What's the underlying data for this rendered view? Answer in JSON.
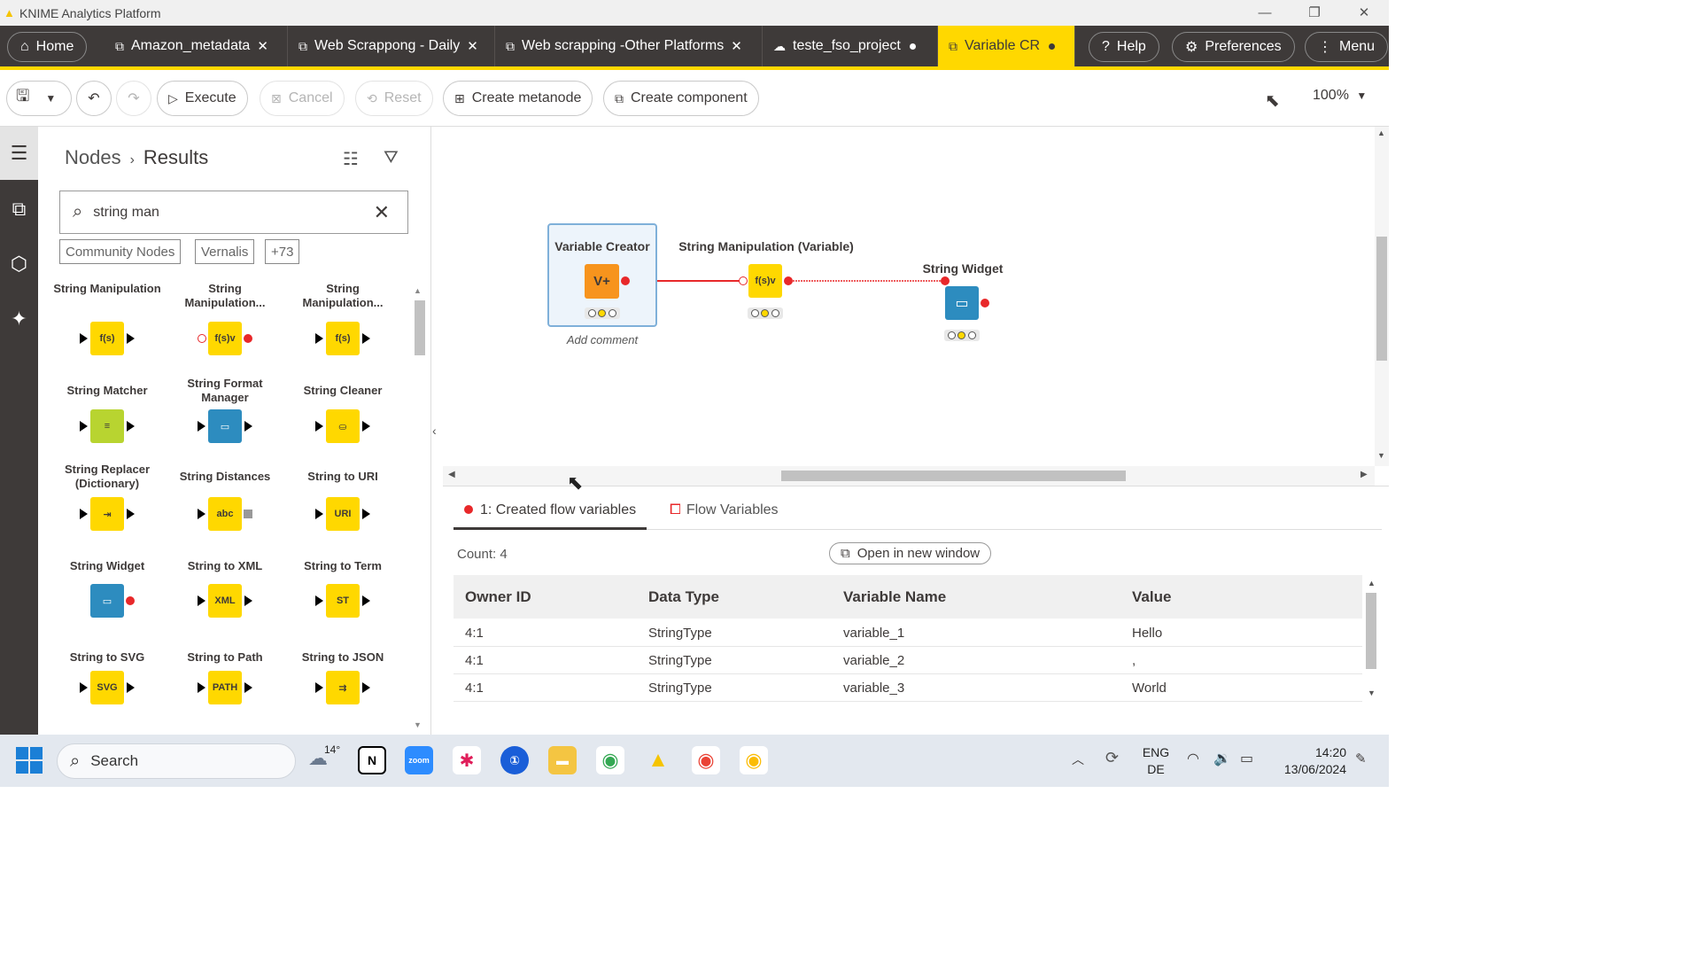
{
  "window": {
    "title": "KNIME Analytics Platform"
  },
  "tabs": [
    {
      "label": "Home"
    },
    {
      "label": "Amazon_metadata"
    },
    {
      "label": "Web Scrappong - Daily"
    },
    {
      "label": "Web scrapping -Other Platforms"
    },
    {
      "label": "teste_fso_project"
    },
    {
      "label": "Variable CR"
    }
  ],
  "top_right": {
    "help": "Help",
    "preferences": "Preferences",
    "menu": "Menu"
  },
  "toolbar": {
    "execute": "Execute",
    "cancel": "Cancel",
    "reset": "Reset",
    "create_metanode": "Create metanode",
    "create_component": "Create component",
    "zoom": "100%"
  },
  "side_panel": {
    "breadcrumb_root": "Nodes",
    "breadcrumb_current": "Results",
    "search_value": "string man",
    "tags": [
      "Community Nodes",
      "Vernalis",
      "+73"
    ],
    "nodes": [
      {
        "label": "String Manipulation",
        "color": "#ffd800",
        "glyph": "f(s)"
      },
      {
        "label": "String Manipulation...",
        "color": "#ffd800",
        "glyph": "f(s)v"
      },
      {
        "label": "String Manipulation...",
        "color": "#ffd800",
        "glyph": "f(s)"
      },
      {
        "label": "String Matcher",
        "color": "#b8d430",
        "glyph": "≡"
      },
      {
        "label": "String Format Manager",
        "color": "#2d8cbf",
        "glyph": "▭"
      },
      {
        "label": "String Cleaner",
        "color": "#ffd800",
        "glyph": "⛀"
      },
      {
        "label": "String Replacer (Dictionary)",
        "color": "#ffd800",
        "glyph": "⇥"
      },
      {
        "label": "String Distances",
        "color": "#ffd800",
        "glyph": "abc"
      },
      {
        "label": "String to URI",
        "color": "#ffd800",
        "glyph": "URI"
      },
      {
        "label": "String Widget",
        "color": "#2d8cbf",
        "glyph": "▭"
      },
      {
        "label": "String to XML",
        "color": "#ffd800",
        "glyph": "XML"
      },
      {
        "label": "String to Term",
        "color": "#ffd800",
        "glyph": "ST"
      },
      {
        "label": "String to SVG",
        "color": "#ffd800",
        "glyph": "SVG"
      },
      {
        "label": "String to Path",
        "color": "#ffd800",
        "glyph": "PATH"
      },
      {
        "label": "String to JSON",
        "color": "#ffd800",
        "glyph": "⇉"
      }
    ]
  },
  "canvas": {
    "nodes": [
      {
        "title": "Variable Creator",
        "glyph": "V+",
        "color": "#f7941d",
        "comment": "Add comment"
      },
      {
        "title": "String Manipulation (Variable)",
        "glyph": "f(s)v",
        "color": "#ffd800"
      },
      {
        "title": "String Widget",
        "glyph": "▭",
        "color": "#2d8cbf"
      }
    ]
  },
  "bottom_panel": {
    "tab_active": "1: Created flow variables",
    "tab_other": "Flow Variables",
    "count": "Count: 4",
    "open_new_window": "Open in new window",
    "columns": [
      "Owner ID",
      "Data Type",
      "Variable Name",
      "Value"
    ],
    "rows": [
      [
        "4:1",
        "StringType",
        "variable_1",
        "Hello"
      ],
      [
        "4:1",
        "StringType",
        "variable_2",
        ","
      ],
      [
        "4:1",
        "StringType",
        "variable_3",
        "World"
      ]
    ]
  },
  "taskbar": {
    "search_placeholder": "Search",
    "weather": "14°",
    "lang_top": "ENG",
    "lang_bottom": "DE",
    "time": "14:20",
    "date": "13/06/2024"
  },
  "colors": {
    "accent": "#ffd800",
    "dark": "#3e3a39",
    "flowvar": "#e8282a"
  }
}
